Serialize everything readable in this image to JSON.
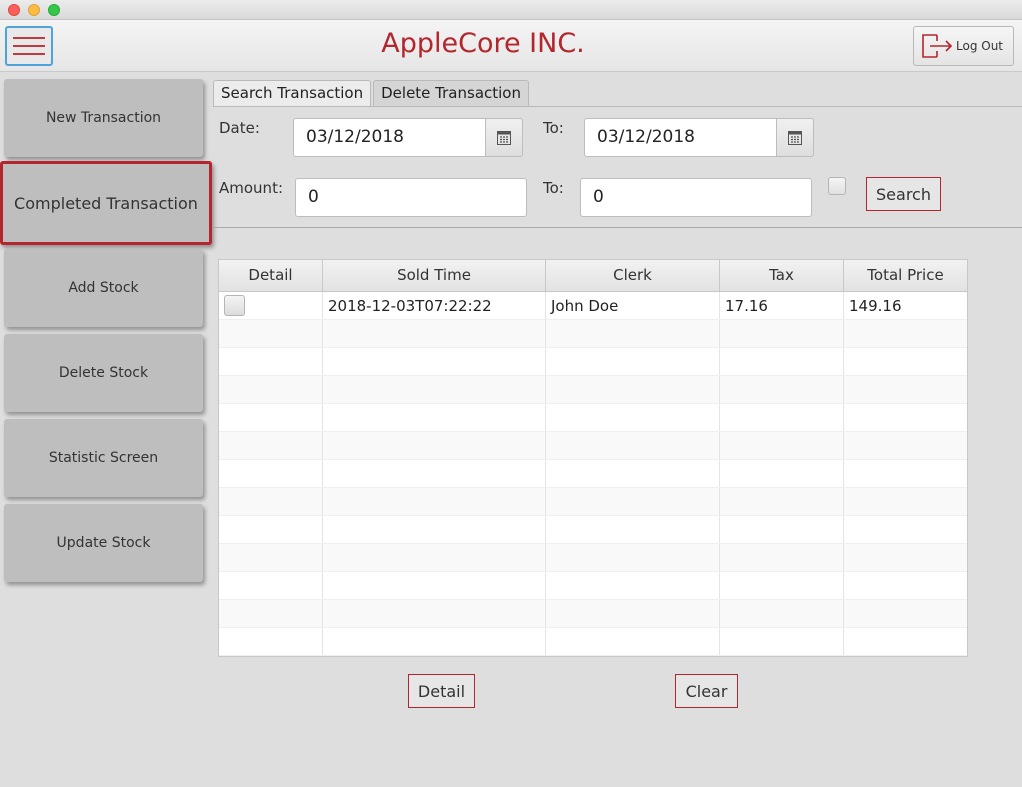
{
  "app": {
    "title": "AppleCore INC."
  },
  "header": {
    "logout_label": "Log Out"
  },
  "sidebar": {
    "items": [
      {
        "label": "New Transaction",
        "active": false
      },
      {
        "label": "Completed Transaction",
        "active": true
      },
      {
        "label": "Add Stock",
        "active": false
      },
      {
        "label": "Delete Stock",
        "active": false
      },
      {
        "label": "Statistic Screen",
        "active": false
      },
      {
        "label": "Update Stock",
        "active": false
      }
    ]
  },
  "tabs": [
    {
      "label": "Search Transaction",
      "selected": true
    },
    {
      "label": "Delete Transaction",
      "selected": false
    }
  ],
  "search": {
    "date_label": "Date:",
    "date_from": "03/12/2018",
    "date_to_label": "To:",
    "date_to": "03/12/2018",
    "amount_label": "Amount:",
    "amount_from": "0",
    "amount_to_label": "To:",
    "amount_to": "0",
    "amount_checkbox_checked": false,
    "search_label": "Search"
  },
  "table": {
    "columns": [
      "Detail",
      "Sold Time",
      "Clerk",
      "Tax",
      "Total Price"
    ],
    "rows": [
      {
        "detail_checked": false,
        "sold_time": "2018-12-03T07:22:22",
        "clerk": "John Doe",
        "tax": "17.16",
        "total_price": "149.16"
      }
    ]
  },
  "actions": {
    "detail_label": "Detail",
    "clear_label": "Clear"
  },
  "colors": {
    "accent": "#b3262d",
    "menu_border": "#4fa3d9",
    "background": "#dedede"
  },
  "icons": {
    "menu": "hamburger-icon",
    "logout": "logout-icon",
    "calendar": "calendar-icon"
  }
}
